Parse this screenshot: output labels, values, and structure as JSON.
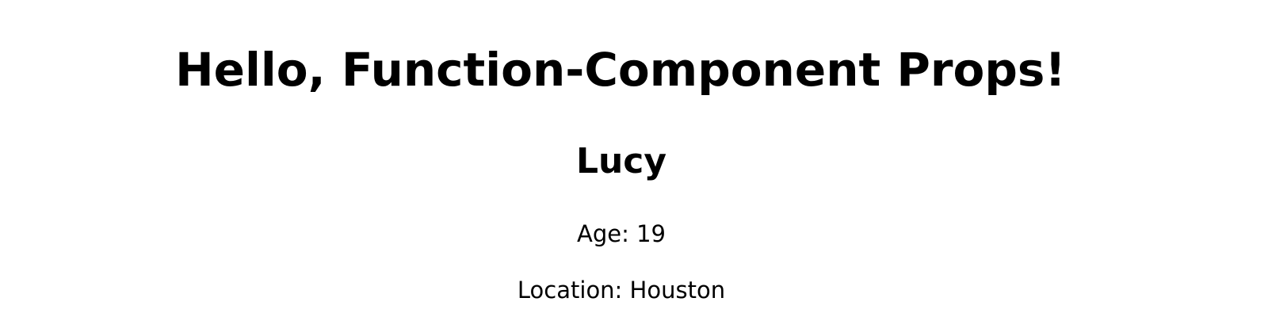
{
  "header": {
    "title": "Hello, Function-Component Props!"
  },
  "profile": {
    "name": "Lucy",
    "age_text": "Age: 19",
    "location_text": "Location: Houston"
  }
}
